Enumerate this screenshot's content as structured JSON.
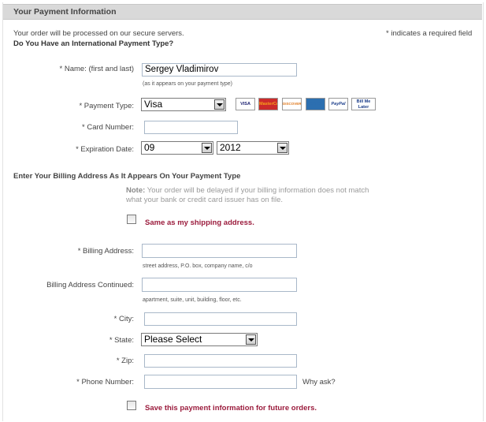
{
  "header": {
    "title": "Your Payment Information"
  },
  "intro": {
    "secure_text": "Your order will be processed on our secure servers.",
    "required_note": "* indicates a required field",
    "international_question": "Do You Have an International Payment Type?"
  },
  "name": {
    "label": "* Name: (first and last)",
    "value": "Sergey Vladimirov",
    "hint": "(as it appears on your payment type)"
  },
  "payment_type": {
    "label": "* Payment Type:",
    "selected": "Visa",
    "cards": [
      "VISA",
      "MasterCard",
      "DISCOVER",
      "AMEX",
      "PayPal",
      "Bill Me Later"
    ]
  },
  "card_number": {
    "label": "* Card Number:",
    "value": ""
  },
  "expiration": {
    "label": "* Expiration Date:",
    "month": "09",
    "year": "2012"
  },
  "billing": {
    "heading": "Enter Your Billing Address As It Appears On Your Payment Type",
    "note_label": "Note:",
    "note_text": "Your order will be delayed if your billing information does not match what your bank or credit card issuer has on file.",
    "same_as_shipping": "Same as my shipping address.",
    "address_label": "* Billing Address:",
    "address_value": "",
    "address_hint": "street address, P.O. box, company name, c/o",
    "address2_label": "Billing Address Continued:",
    "address2_value": "",
    "address2_hint": "apartment, suite, unit, building, floor, etc.",
    "city_label": "* City:",
    "city_value": "",
    "state_label": "* State:",
    "state_selected": "Please Select",
    "zip_label": "* Zip:",
    "zip_value": "",
    "phone_label": "* Phone Number:",
    "phone_value": "",
    "why_ask": "Why ask?",
    "save_info": "Save this payment information for future orders."
  }
}
